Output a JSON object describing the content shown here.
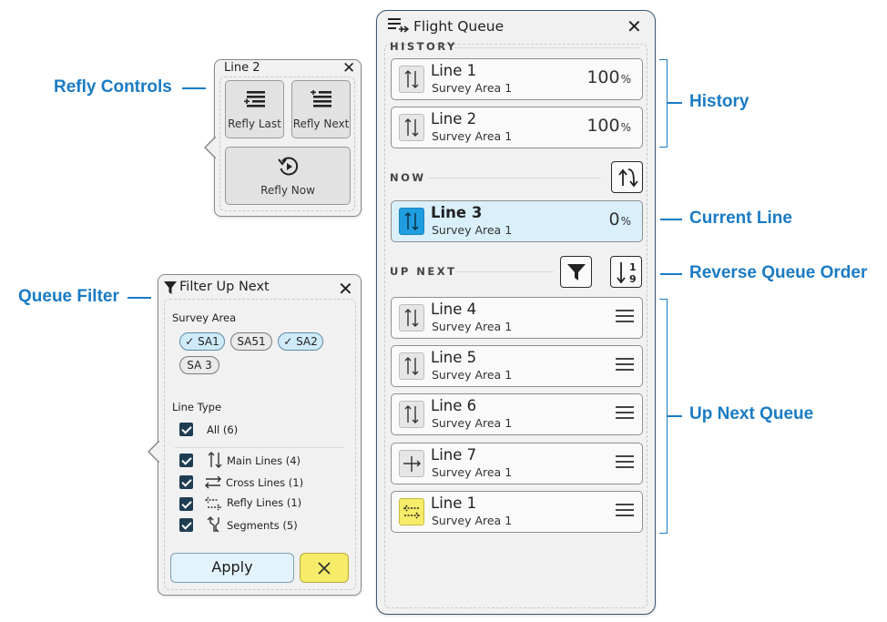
{
  "annotations": {
    "refly_controls": "Refly Controls",
    "queue_filter": "Queue Filter",
    "history": "History",
    "current_line": "Current Line",
    "reverse_queue_order": "Reverse Queue Order",
    "up_next_queue": "Up Next Queue"
  },
  "queue": {
    "title": "Flight Queue",
    "history_label": "HISTORY",
    "now_label": "NOW",
    "up_next_label": "UP NEXT",
    "history": [
      {
        "title": "Line 1",
        "area": "Survey Area 1",
        "pct": "100",
        "unit": "%"
      },
      {
        "title": "Line 2",
        "area": "Survey Area 1",
        "pct": "100",
        "unit": "%"
      }
    ],
    "current": {
      "title": "Line 3",
      "area": "Survey Area 1",
      "pct": "0",
      "unit": "%"
    },
    "up_next": [
      {
        "title": "Line 4",
        "area": "Survey Area 1",
        "icon": "main-line-icon"
      },
      {
        "title": "Line 5",
        "area": "Survey Area 1",
        "icon": "main-line-icon"
      },
      {
        "title": "Line 6",
        "area": "Survey Area 1",
        "icon": "main-line-icon"
      },
      {
        "title": "Line 7",
        "area": "Survey Area 1",
        "icon": "cross-line-icon"
      },
      {
        "title": "Line 1",
        "area": "Survey Area 1",
        "icon": "refly-line-icon"
      }
    ],
    "reverse_order_icon_text": {
      "top": "1",
      "bottom": "9"
    }
  },
  "refly": {
    "title": "Line 2",
    "refly_last": "Refly Last",
    "refly_next": "Refly Next",
    "refly_now": "Refly Now"
  },
  "filter": {
    "title": "Filter Up Next",
    "survey_area_label": "Survey Area",
    "chips": [
      {
        "label": "✓ SA1",
        "selected": true
      },
      {
        "label": "SA51",
        "selected": false
      },
      {
        "label": "✓ SA2",
        "selected": true
      },
      {
        "label": "SA 3",
        "selected": false
      }
    ],
    "line_type_label": "Line Type",
    "all": "All (6)",
    "types": [
      {
        "label": "Main Lines (4)",
        "checked": true
      },
      {
        "label": "Cross Lines (1)",
        "checked": true
      },
      {
        "label": "Refly Lines (1)",
        "checked": true
      },
      {
        "label": "Segments (5)",
        "checked": true
      }
    ],
    "apply": "Apply"
  },
  "colors": {
    "accent": "#1a7bc4",
    "current_bg": "#d9f0fb",
    "apply_bg": "#e3f3fc",
    "cancel_bg": "#f6ec6a"
  }
}
